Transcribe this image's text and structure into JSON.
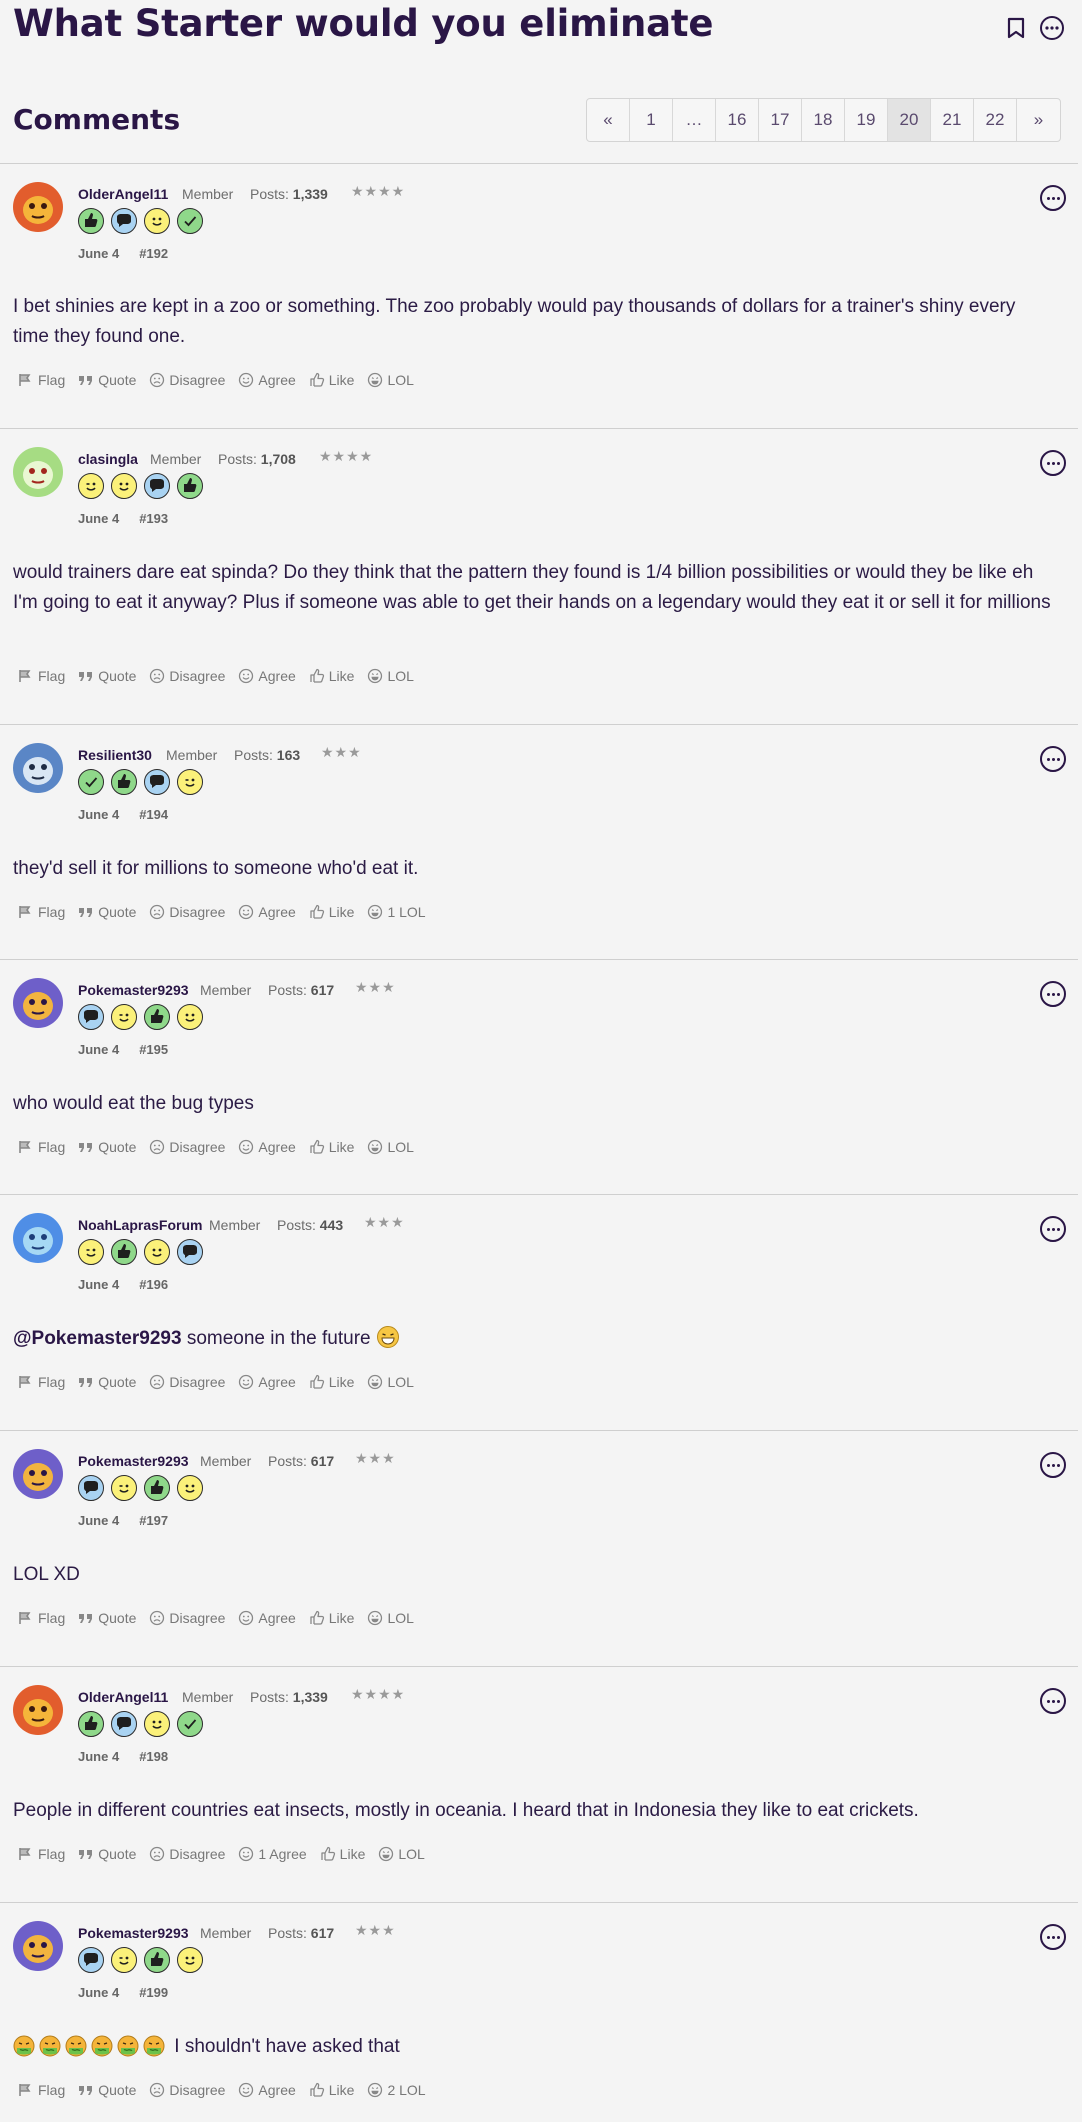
{
  "header": {
    "title": "What Starter would you eliminate",
    "bookmark_icon": "bookmark-icon",
    "more_icon": "more-options-icon"
  },
  "comments": {
    "heading": "Comments"
  },
  "pagination": {
    "prev": "«",
    "next": "»",
    "pages": [
      "1",
      "…",
      "16",
      "17",
      "18",
      "19",
      "20",
      "21",
      "22"
    ],
    "current": "20"
  },
  "actions": {
    "flag": "Flag",
    "quote": "Quote",
    "disagree": "Disagree",
    "agree": "Agree",
    "like": "Like",
    "lol": "LOL"
  },
  "posts": [
    {
      "username": "OlderAngel11",
      "role": "Member",
      "posts_label": "Posts:",
      "post_count": "1,339",
      "stars": "★★★★",
      "badges": [
        "thumbs-up-badge",
        "speech-bubble-badge",
        "smile-badge",
        "check-badge"
      ],
      "date": "June 4",
      "number": "#192",
      "text": "I bet shinies are kept in a zoo or something. The zoo probably would pay thousands of dollars for a trainer's shiny every time they found one.",
      "agree_label": "Agree",
      "lol_label": "LOL"
    },
    {
      "username": "clasingla",
      "role": "Member",
      "posts_label": "Posts:",
      "post_count": "1,708",
      "stars": "★★★★",
      "badges": [
        "wink-badge",
        "smile-badge",
        "speech-bubble-badge",
        "thumbs-up-badge"
      ],
      "date": "June 4",
      "number": "#193",
      "text": "would trainers dare eat spinda? Do they think that the pattern they found is 1/4 billion possibilities or would they be like eh I'm going to eat it anyway? Plus if someone was able to get their hands on a legendary would they eat it or sell it for millions",
      "agree_label": "Agree",
      "lol_label": "LOL"
    },
    {
      "username": "Resilient30",
      "role": "Member",
      "posts_label": "Posts:",
      "post_count": "163",
      "stars": "★★★",
      "badges": [
        "check-badge",
        "thumbs-up-badge",
        "speech-bubble-badge",
        "wink-badge"
      ],
      "date": "June 4",
      "number": "#194",
      "text": "they'd sell it for millions to someone who'd eat it.",
      "agree_label": "Agree",
      "lol_label": "1 LOL"
    },
    {
      "username": "Pokemaster9293",
      "role": "Member",
      "posts_label": "Posts:",
      "post_count": "617",
      "stars": "★★★",
      "badges": [
        "speech-bubble-badge",
        "wink-badge",
        "thumbs-up-badge",
        "smile-badge"
      ],
      "date": "June 4",
      "number": "#195",
      "text": "who would eat the bug types",
      "agree_label": "Agree",
      "lol_label": "LOL"
    },
    {
      "username": "NoahLaprasForum",
      "role": "Member",
      "posts_label": "Posts:",
      "post_count": "443",
      "stars": "★★★",
      "badges": [
        "wink-badge",
        "thumbs-up-badge",
        "smile-badge",
        "speech-bubble-badge"
      ],
      "date": "June 4",
      "number": "#196",
      "mention": "@Pokemaster9293",
      "text": "someone in the future",
      "agree_label": "Agree",
      "lol_label": "LOL"
    },
    {
      "username": "Pokemaster9293",
      "role": "Member",
      "posts_label": "Posts:",
      "post_count": "617",
      "stars": "★★★",
      "badges": [
        "speech-bubble-badge",
        "wink-badge",
        "thumbs-up-badge",
        "smile-badge"
      ],
      "date": "June 4",
      "number": "#197",
      "text": "LOL XD",
      "agree_label": "Agree",
      "lol_label": "LOL"
    },
    {
      "username": "OlderAngel11",
      "role": "Member",
      "posts_label": "Posts:",
      "post_count": "1,339",
      "stars": "★★★★",
      "badges": [
        "thumbs-up-badge",
        "speech-bubble-badge",
        "smile-badge",
        "check-badge"
      ],
      "date": "June 4",
      "number": "#198",
      "text": "People in different countries eat insects, mostly in oceania. I heard that in Indonesia they like to eat crickets.",
      "agree_label": "1 Agree",
      "lol_label": "LOL"
    },
    {
      "username": "Pokemaster9293",
      "role": "Member",
      "posts_label": "Posts:",
      "post_count": "617",
      "stars": "★★★",
      "badges": [
        "speech-bubble-badge",
        "wink-badge",
        "thumbs-up-badge",
        "smile-badge"
      ],
      "date": "June 4",
      "number": "#199",
      "text": "I shouldn't have asked that",
      "agree_label": "Agree",
      "lol_label": "2 LOL"
    }
  ],
  "colors": {
    "background": "#f4f4f4",
    "title": "#2a1646",
    "badge_green": "#8fd88a",
    "badge_blue": "#a9d3f2",
    "badge_yellow": "#fbf17a"
  }
}
